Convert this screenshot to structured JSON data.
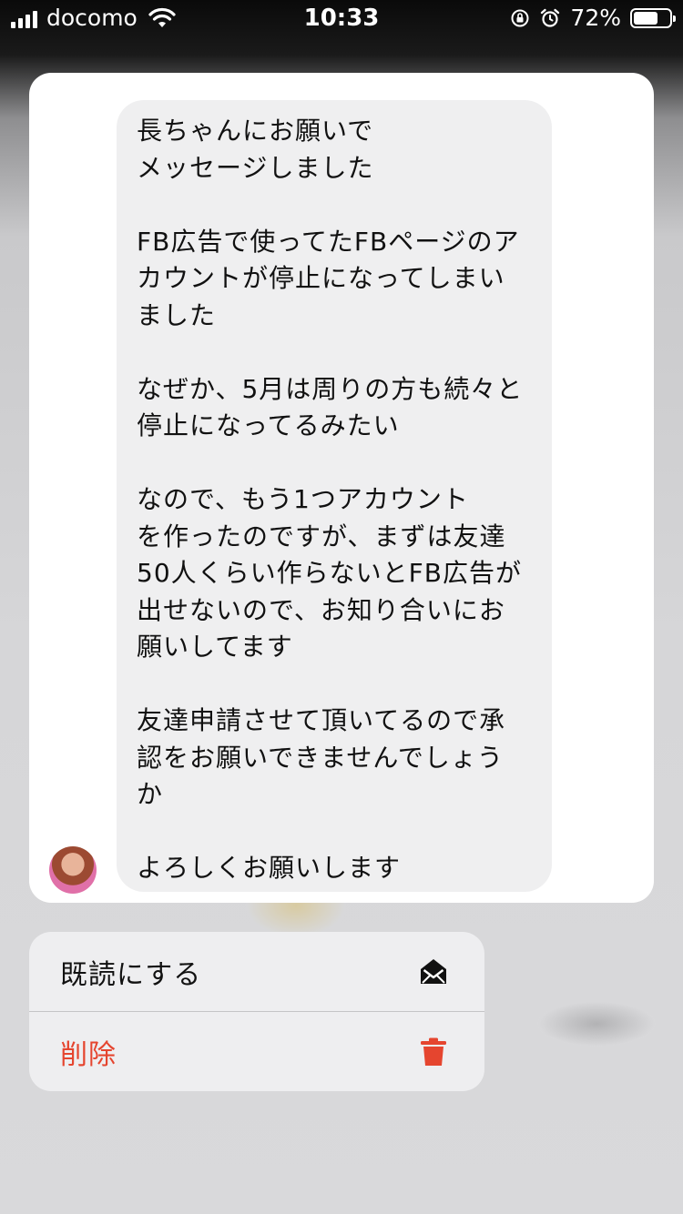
{
  "status_bar": {
    "carrier": "docomo",
    "time": "10:33",
    "battery_percent": "72%",
    "battery_level": 0.72
  },
  "message": {
    "text": "長ちゃんにお願いで\nメッセージしました\n\nFB広告で使ってたFBページのア\nカウントが停止になってしまい\nました\n\nなぜか、5月は周りの方も続々と\n停止になってるみたい\n\nなので、もう1つアカウント\nを作ったのですが、まずは友達\n50人くらい作らないとFB広告が\n出せないので、お知り合いにお\n願いしてます\n\n友達申請させて頂いてるので承\n認をお願いできませんでしょう\nか\n\nよろしくお願いします"
  },
  "menu": {
    "items": [
      {
        "label": "既読にする",
        "icon": "envelope-open-icon"
      },
      {
        "label": "削除",
        "icon": "trash-icon",
        "color": "#e5452f"
      }
    ]
  }
}
